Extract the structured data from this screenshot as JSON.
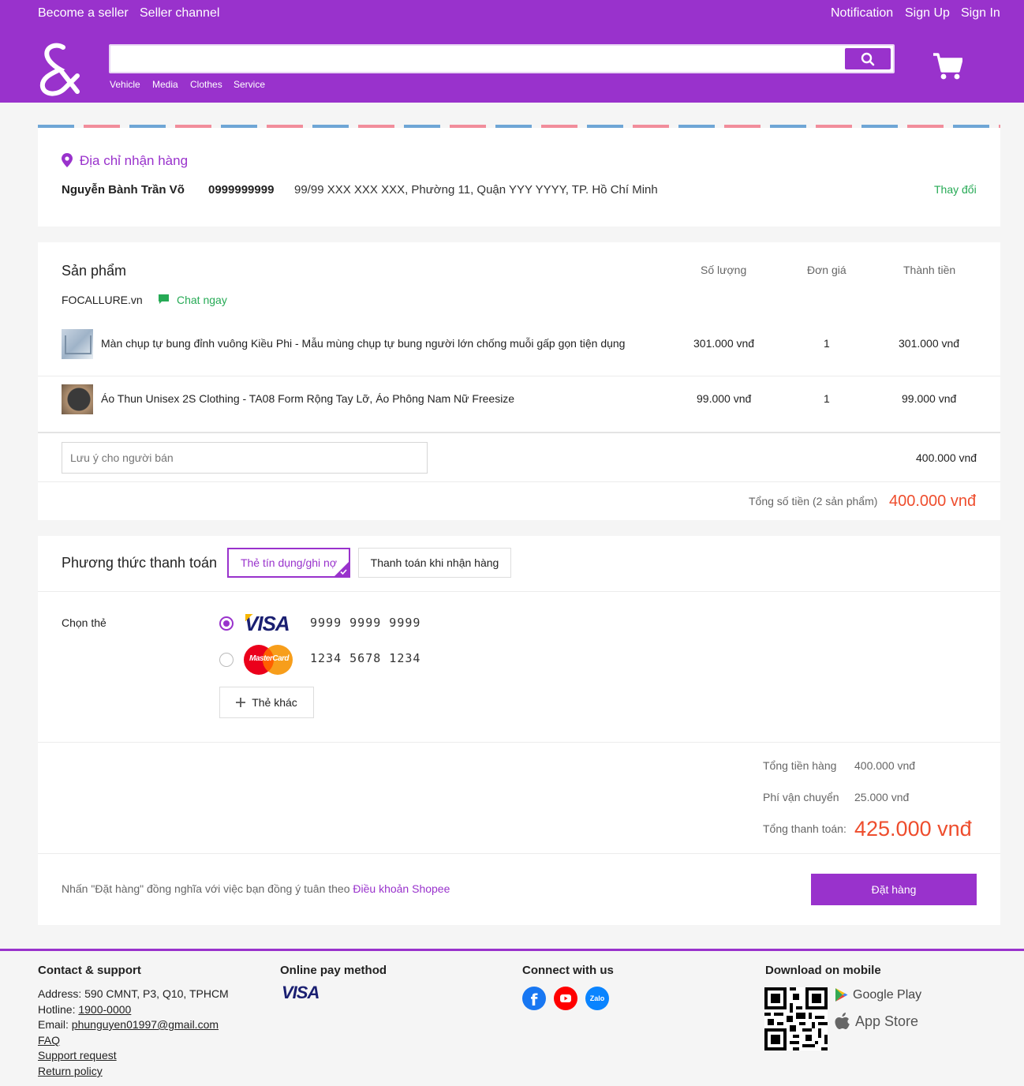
{
  "topnav": {
    "become_seller": "Become a seller",
    "seller_channel": "Seller channel",
    "notification": "Notification",
    "sign_up": "Sign Up",
    "sign_in": "Sign In"
  },
  "search": {
    "value": "",
    "placeholder": ""
  },
  "categories": [
    "Vehicle",
    "Media",
    "Clothes",
    "Service"
  ],
  "address": {
    "title": "Địa chỉ nhận hàng",
    "name": "Nguyễn Bành Trần Võ",
    "phone": "0999999999",
    "full_address": "99/99 XXX XXX XXX, Phường 11, Quận YYY YYYY, TP. Hồ Chí Minh",
    "change_label": "Thay đổi"
  },
  "products": {
    "title": "Sản phẩm",
    "headers": {
      "qty": "Số lượng",
      "unit_price": "Đơn giá",
      "total": "Thành tiền"
    },
    "shop_name": "FOCALLURE.vn",
    "chat_label": "Chat ngay",
    "items": [
      {
        "name": "Màn chụp tự bung đỉnh vuông Kiều Phi - Mẫu mùng chụp tự bung người lớn chống muỗi gấp gọn tiện dụng",
        "col1": "301.000 vnđ",
        "col2": "1",
        "col3": "301.000 vnđ"
      },
      {
        "name": "Áo Thun Unisex 2S Clothing - TA08 Form Rộng Tay Lỡ, Áo Phông Nam Nữ Freesize",
        "col1": "99.000 vnđ",
        "col2": "1",
        "col3": "99.000 vnđ"
      }
    ],
    "note_placeholder": "Lưu ý cho người bán",
    "shop_subtotal": "400.000 vnđ",
    "total_label": "Tổng số tiền (2 sản phẩm)",
    "total_value": "400.000 vnđ"
  },
  "payment": {
    "title": "Phương thức thanh toán",
    "tab_card": "Thẻ tín dụng/ghi nợ",
    "tab_cod": "Thanh toán khi nhận hàng",
    "choose_card_label": "Chọn thẻ",
    "cards": [
      {
        "brand": "VISA",
        "number": "9999 9999 9999",
        "selected": true
      },
      {
        "brand": "MasterCard",
        "number": "1234 5678 1234",
        "selected": false
      }
    ],
    "other_card_label": "Thẻ khác"
  },
  "summary": {
    "goods_label": "Tổng tiền hàng",
    "goods_value": "400.000 vnđ",
    "shipping_label": "Phí vận chuyển",
    "shipping_value": "25.000 vnđ",
    "grand_label": "Tổng thanh toán:",
    "grand_value": "425.000 vnđ"
  },
  "order": {
    "terms_prefix": "Nhấn \"Đặt hàng\" đồng nghĩa với việc bạn đồng ý tuân theo",
    "terms_link": "Điều khoản Shopee",
    "button_label": "Đặt hàng"
  },
  "footer": {
    "contact": {
      "title": "Contact & support",
      "address": "Address: 590 CMNT, P3, Q10, TPHCM",
      "hotline_label": "Hotline:",
      "hotline": "1900-0000",
      "email_label": "Email:",
      "email": "phunguyen01997@gmail.com",
      "faq": "FAQ",
      "support": "Support request",
      "return_policy": "Return policy"
    },
    "pay": {
      "title": "Online pay method",
      "visa": "VISA"
    },
    "connect": {
      "title": "Connect with us",
      "zalo": "Zalo"
    },
    "mobile": {
      "title": "Download on mobile",
      "google_play": "Google Play",
      "app_store": "App Store"
    }
  },
  "colors": {
    "brand": "#9932cc",
    "accent_red": "#ee4d2d",
    "green": "#26aa55"
  }
}
